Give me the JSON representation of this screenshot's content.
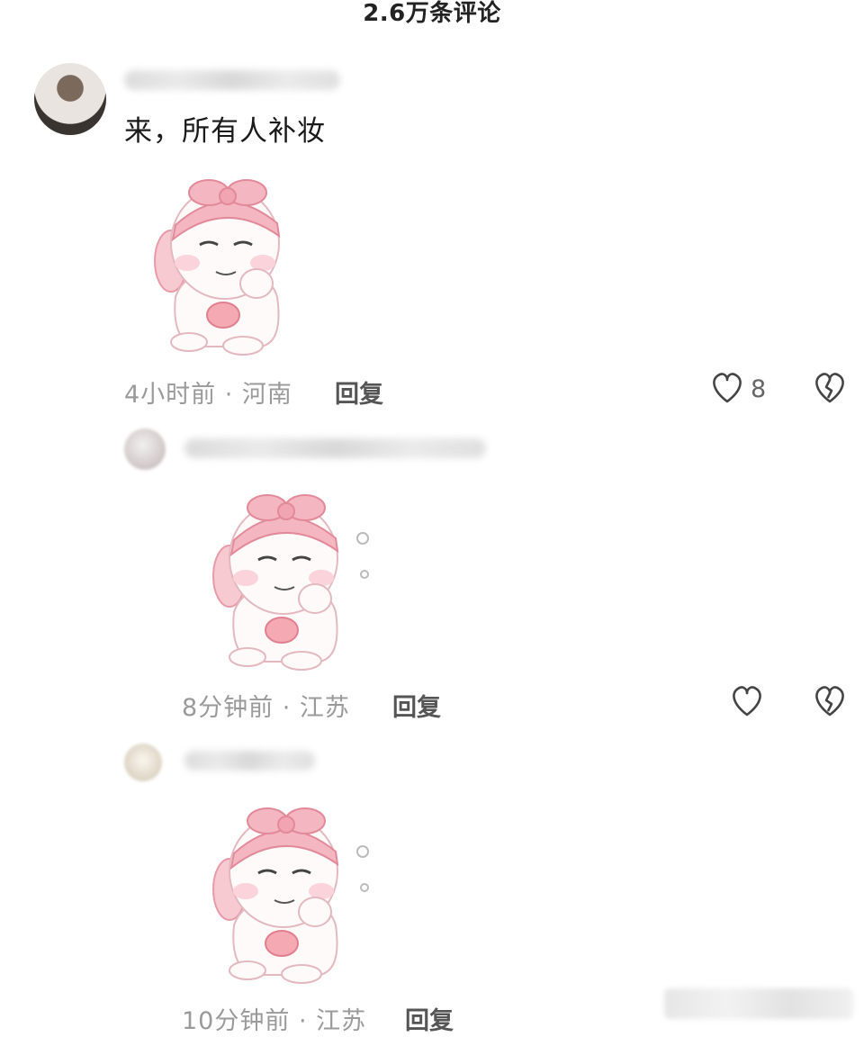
{
  "header": {
    "title": "2.6万条评论"
  },
  "comments": [
    {
      "text": "来，所有人补妆",
      "time_location": "4小时前 · 河南",
      "reply_label": "回复",
      "like_count": "8"
    },
    {
      "time_location": "8分钟前 · 江苏",
      "reply_label": "回复"
    },
    {
      "time_location": "10分钟前 · 江苏",
      "reply_label": "回复"
    }
  ],
  "icons": {
    "like": "heart-outline-icon",
    "dislike": "broken-heart-icon"
  },
  "colors": {
    "background": "#ffffff",
    "meta_text": "#9a9a9a",
    "icon_stroke": "#444444",
    "sticker_pink": "#f4b6c0"
  }
}
